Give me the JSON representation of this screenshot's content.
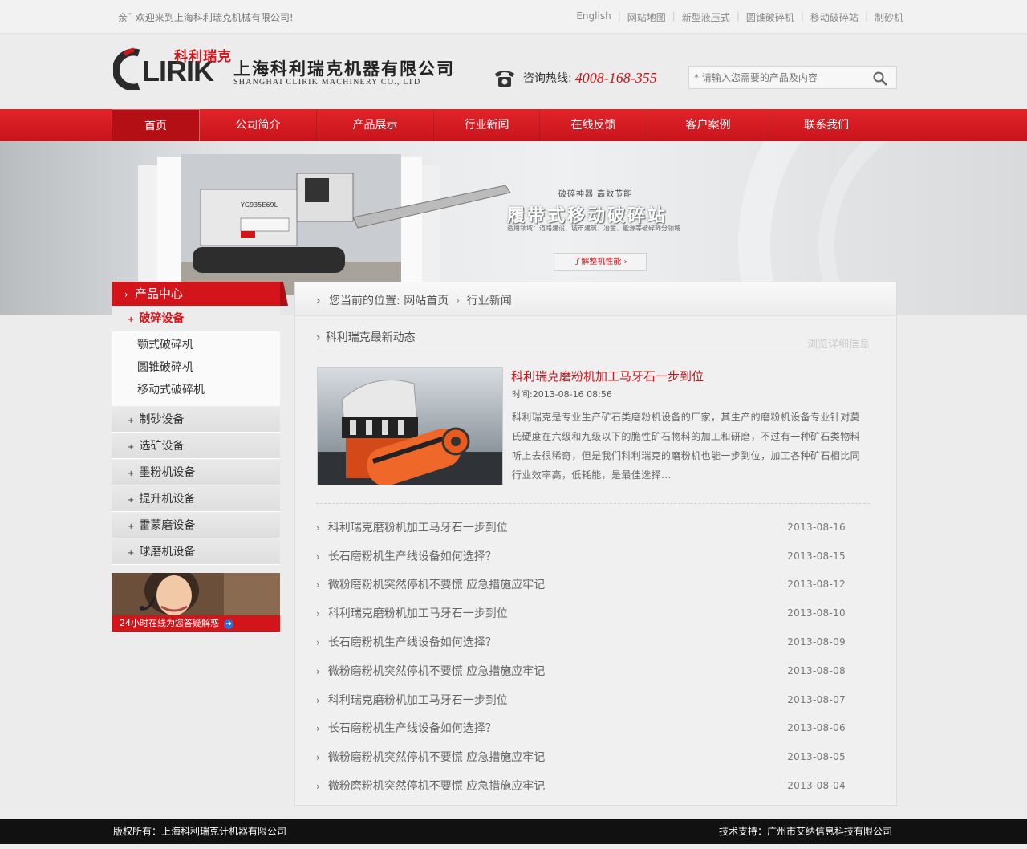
{
  "topbar": {
    "welcome": "亲ˇ  欢迎来到上海科利瑞克机械有限公司!",
    "links": [
      "English",
      "网站地图",
      "新型液压式",
      "圆锥破碎机",
      "移动破碎站",
      "制砂机"
    ]
  },
  "logo": {
    "mark": "CLIRIK",
    "brand_cn": "科利瑞克",
    "company_cn": "上海科利瑞克机器有限公司",
    "company_en": "SHANGHAI CLIRIK MACHINERY CO., LTD"
  },
  "hotline": {
    "label": "咨询热线:",
    "number": "4008-168-355"
  },
  "search": {
    "placeholder": "* 请输入您需要的产品及内容"
  },
  "nav": [
    "首页",
    "公司简介",
    "产品展示",
    "行业新闻",
    "在线反馈",
    "客户案例",
    "联系我们"
  ],
  "banner": {
    "slogan": "破碎神器   高效节能",
    "title": "履带式移动破碎站",
    "subtitle": "适用领域：道路建设、城市建筑、冶金、能源等破碎筛分领域",
    "button": "了解整机性能  ›",
    "machine_label": "YG935E69L"
  },
  "sidebar": {
    "title": "产品中心",
    "open_category": "破碎设备",
    "sub_items": [
      "颚式破碎机",
      "圆锥破碎机",
      "移动式破碎机"
    ],
    "categories": [
      "制砂设备",
      "选矿设备",
      "墨粉机设备",
      "提升机设备",
      "雷蒙磨设备",
      "球磨机设备"
    ],
    "service_text": "24小时在线为您答疑解惑"
  },
  "breadcrumb": {
    "prefix": "您当前的位置:",
    "home": "网站首页",
    "current": "行业新闻"
  },
  "section": {
    "title": "科利瑞克最新动态",
    "more": "浏览详细信息"
  },
  "featured": {
    "title": "科利瑞克磨粉机加工马牙石一步到位",
    "time": "时间:2013-08-16  08:56",
    "text": "科利瑞克是专业生产矿石类磨粉机设备的厂家，其生产的磨粉机设备专业针对莫氏硬度在六级和九级以下的脆性矿石物料的加工和研磨，不过有一种矿石类物料听上去很稀奇，但是我们科利瑞克的磨粉机也能一步到位，加工各种矿石相比同行业效率高，低耗能，是最佳选择..."
  },
  "news": [
    {
      "title": "科利瑞克磨粉机加工马牙石一步到位",
      "date": "2013-08-16"
    },
    {
      "title": "长石磨粉机生产线设备如何选择？",
      "date": "2013-08-15"
    },
    {
      "title": "微粉磨粉机突然停机不要慌 应急措施应牢记",
      "date": "2013-08-12"
    },
    {
      "title": "科利瑞克磨粉机加工马牙石一步到位",
      "date": "2013-08-10"
    },
    {
      "title": "长石磨粉机生产线设备如何选择？",
      "date": "2013-08-09"
    },
    {
      "title": "微粉磨粉机突然停机不要慌 应急措施应牢记",
      "date": "2013-08-08"
    },
    {
      "title": "科利瑞克磨粉机加工马牙石一步到位",
      "date": "2013-08-07"
    },
    {
      "title": "长石磨粉机生产线设备如何选择？",
      "date": "2013-08-06"
    },
    {
      "title": "微粉磨粉机突然停机不要慌 应急措施应牢记",
      "date": "2013-08-05"
    },
    {
      "title": "微粉磨粉机突然停机不要慌 应急措施应牢记",
      "date": "2013-08-04"
    }
  ],
  "footer": {
    "copyright": "版权所有：上海科利瑞克计机器有限公司",
    "support": "技术支持：广州市艾纳信息科技有限公司"
  },
  "colors": {
    "brand_red": "#d3141b",
    "footer_bg": "#111111"
  },
  "icons": {
    "phone": "phone-icon",
    "search": "search-icon",
    "arrow": "chevron-right-icon"
  }
}
